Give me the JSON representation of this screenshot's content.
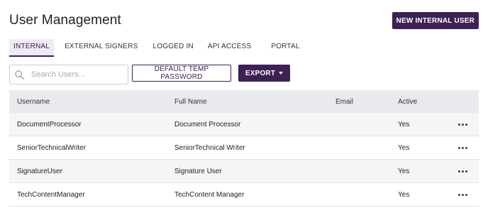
{
  "header": {
    "title": "User Management",
    "new_user_label": "NEW INTERNAL USER"
  },
  "tabs": [
    {
      "label": "INTERNAL",
      "active": true
    },
    {
      "label": "EXTERNAL SIGNERS",
      "active": false
    },
    {
      "label": "LOGGED IN",
      "active": false
    },
    {
      "label": "API ACCESS",
      "active": false
    },
    {
      "label": "PORTAL",
      "active": false
    }
  ],
  "toolbar": {
    "search_placeholder": "Search Users...",
    "search_value": "",
    "temp_password_label": "DEFAULT TEMP PASSWORD",
    "export_label": "EXPORT"
  },
  "table": {
    "columns": [
      "Username",
      "Full Name",
      "Email",
      "Active"
    ],
    "rows": [
      {
        "username": "DocumentProcessor",
        "full_name": "Document Processor",
        "email": "",
        "active": "Yes"
      },
      {
        "username": "SeniorTechnicalWriter",
        "full_name": "SeniorTechnical Writer",
        "email": "",
        "active": "Yes"
      },
      {
        "username": "SignatureUser",
        "full_name": "Signature User",
        "email": "",
        "active": "Yes"
      },
      {
        "username": "TechContentManager",
        "full_name": "TechContent Manager",
        "email": "",
        "active": "Yes"
      }
    ]
  },
  "colors": {
    "accent": "#3d2154",
    "header_bg": "#eaeaee",
    "row_alt_bg": "#f5f5f7"
  },
  "icons": {
    "search": "search-icon",
    "dropdown": "caret-down-icon",
    "row_actions": "more-horizontal-icon"
  }
}
